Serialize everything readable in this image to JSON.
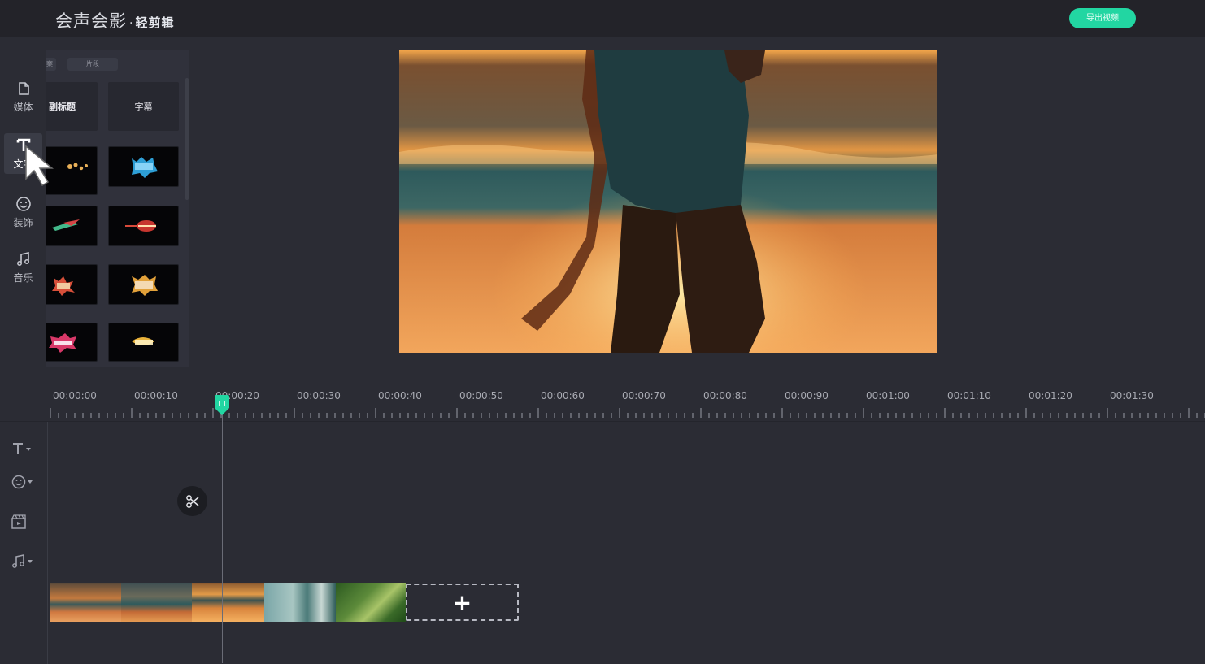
{
  "app": {
    "brand": "会声会影",
    "separator": "·",
    "product": "轻剪辑",
    "export_button": "导出视频",
    "accent_color": "#22d6a2"
  },
  "leftnav": {
    "items": [
      {
        "label": "媒体",
        "icon": "file-icon"
      },
      {
        "label": "文字",
        "icon": "text-t-icon",
        "active": true
      },
      {
        "label": "装饰",
        "icon": "smiley-icon"
      },
      {
        "label": "音乐",
        "icon": "music-note-icon"
      }
    ]
  },
  "panel": {
    "tabs": [
      "案",
      "片段"
    ],
    "tiles": [
      {
        "label": "副标题"
      },
      {
        "label": "字幕"
      },
      {
        "label": ""
      },
      {
        "label": ""
      },
      {
        "label": ""
      },
      {
        "label": ""
      },
      {
        "label": ""
      },
      {
        "label": ""
      },
      {
        "label": ""
      },
      {
        "label": ""
      }
    ]
  },
  "timeline": {
    "ticks": [
      "00:00:00",
      "00:00:10",
      "00:00:20",
      "00:00:30",
      "00:00:40",
      "00:00:50",
      "00:00:60",
      "00:00:70",
      "00:00:80",
      "00:00:90",
      "00:01:00",
      "00:01:10",
      "00:01:20",
      "00:01:30"
    ],
    "add_clip_symbol": "+",
    "track_icons": [
      "text-track-icon",
      "sticker-track-icon",
      "video-track-icon",
      "music-track-icon"
    ]
  }
}
